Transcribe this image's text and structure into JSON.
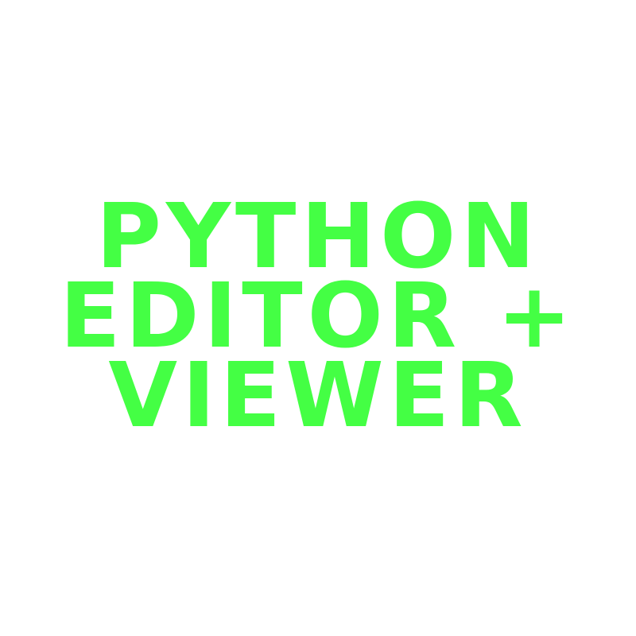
{
  "logo": {
    "lines": [
      "PYTHON",
      "EDITOR +",
      "VIEWER"
    ],
    "color": "#44ff44",
    "background": "#ffffff"
  }
}
